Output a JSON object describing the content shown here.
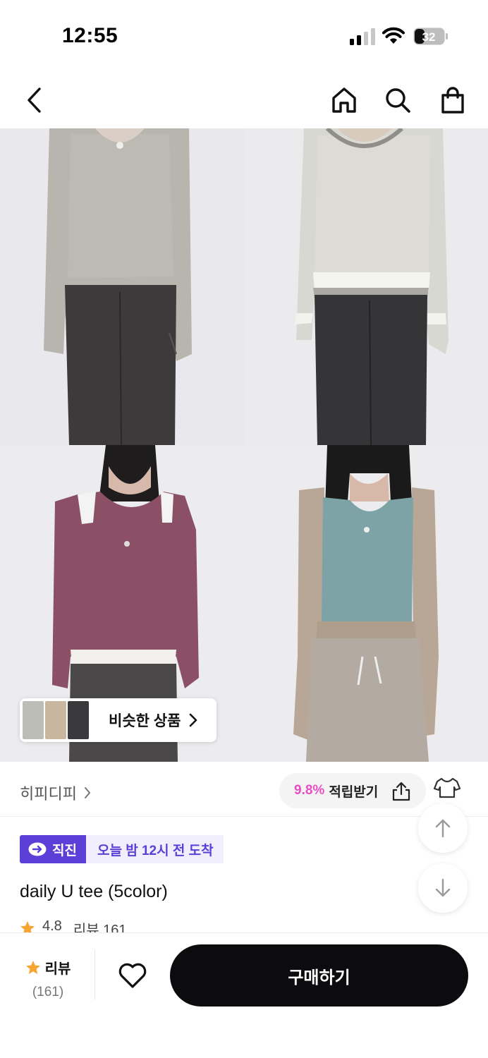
{
  "status_bar": {
    "time": "12:55",
    "battery": "32"
  },
  "nav": {
    "back_icon": "chevron-left-icon",
    "home_icon": "home-icon",
    "search_icon": "search-icon",
    "bag_icon": "shopping-bag-icon"
  },
  "gallery": {
    "photos": [
      "gray-long-sleeve",
      "white-gray-layered",
      "purple-layered",
      "blue-beige-layered"
    ]
  },
  "similar": {
    "label": "비슷한 상품"
  },
  "store": {
    "name": "히피디피",
    "reward_percent": "9.8%",
    "reward_label": "적립받기"
  },
  "delivery": {
    "badge": "직진",
    "eta": "오늘 밤 12시 전 도착"
  },
  "product": {
    "title": "daily U tee (5color)",
    "rating": "4.8",
    "review_text": "리뷰 161"
  },
  "bottom": {
    "review_label": "리뷰",
    "review_count": "(161)",
    "buy_label": "구매하기"
  },
  "colors": {
    "accent": "#5b3fd6",
    "reward": "#e84fc4",
    "star": "#f7a531",
    "buy_bg": "#0c0c0e"
  }
}
